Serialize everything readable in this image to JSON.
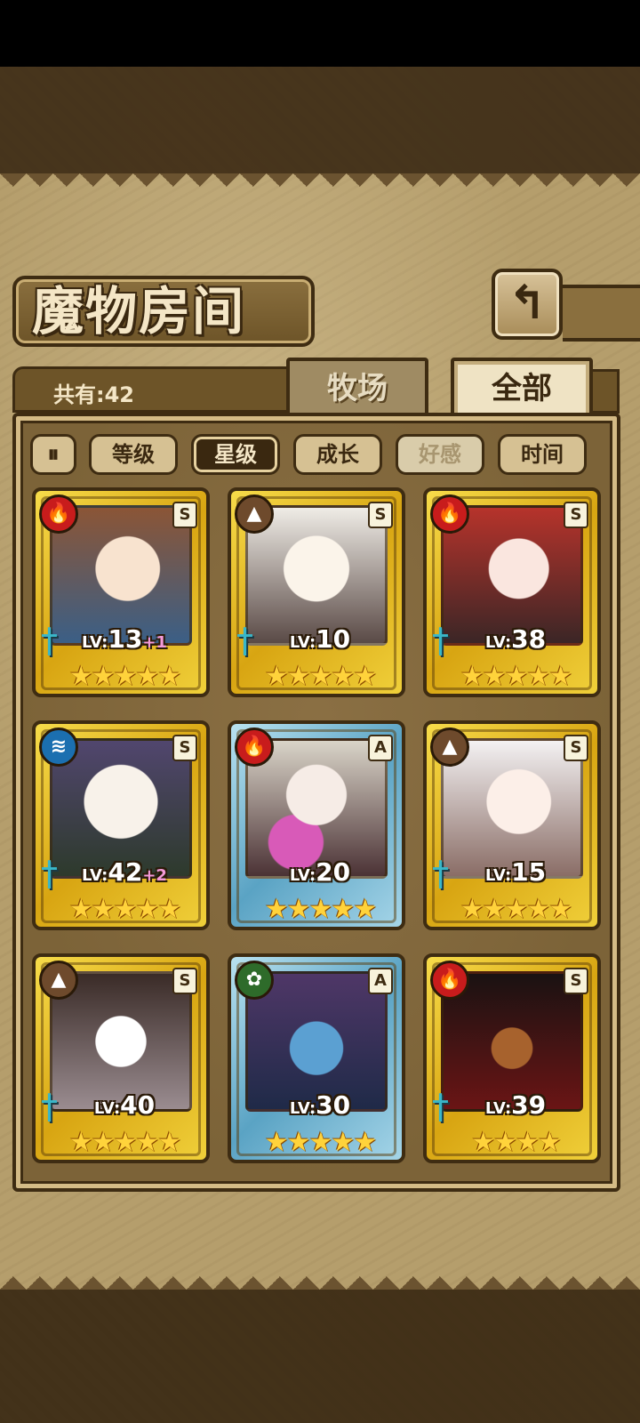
{
  "header": {
    "title": "魔物房间",
    "back_icon": "back-arrow-icon"
  },
  "count": {
    "label": "共有:42"
  },
  "tabs": [
    {
      "label": "牧场",
      "active": false
    },
    {
      "label": "全部",
      "active": true
    }
  ],
  "sort": {
    "toggle_icon": "sort-order-toggle-icon",
    "toggle_glyph": "⏸",
    "buttons": [
      {
        "label": "等级",
        "state": "normal"
      },
      {
        "label": "星级",
        "state": "active"
      },
      {
        "label": "成长",
        "state": "normal"
      },
      {
        "label": "好感",
        "state": "disabled"
      },
      {
        "label": "时间",
        "state": "normal"
      }
    ]
  },
  "cards": [
    {
      "element": "fire",
      "element_glyph": "🔥",
      "rank": "S",
      "lv_prefix": "LV:",
      "lv": "13",
      "plus": "+1",
      "stars": "★★★★★",
      "frame": "gold"
    },
    {
      "element": "earth",
      "element_glyph": "▲",
      "rank": "S",
      "lv_prefix": "LV:",
      "lv": "10",
      "plus": "",
      "stars": "★★★★★",
      "frame": "gold"
    },
    {
      "element": "fire",
      "element_glyph": "🔥",
      "rank": "S",
      "lv_prefix": "LV:",
      "lv": "38",
      "plus": "",
      "stars": "★★★★★",
      "frame": "gold"
    },
    {
      "element": "water",
      "element_glyph": "≋",
      "rank": "S",
      "lv_prefix": "LV:",
      "lv": "42",
      "plus": "+2",
      "stars": "★★★★★",
      "frame": "gold"
    },
    {
      "element": "fire",
      "element_glyph": "🔥",
      "rank": "A",
      "lv_prefix": "LV:",
      "lv": "20",
      "plus": "",
      "stars": "★★★★★",
      "frame": "silver"
    },
    {
      "element": "earth",
      "element_glyph": "▲",
      "rank": "S",
      "lv_prefix": "LV:",
      "lv": "15",
      "plus": "",
      "stars": "★★★★★",
      "frame": "gold"
    },
    {
      "element": "earth",
      "element_glyph": "▲",
      "rank": "S",
      "lv_prefix": "LV:",
      "lv": "40",
      "plus": "",
      "stars": "★★★★★",
      "frame": "gold"
    },
    {
      "element": "wood",
      "element_glyph": "✿",
      "rank": "A",
      "lv_prefix": "LV:",
      "lv": "30",
      "plus": "",
      "stars": "★★★★★",
      "frame": "silver"
    },
    {
      "element": "fire",
      "element_glyph": "🔥",
      "rank": "S",
      "lv_prefix": "LV:",
      "lv": "39",
      "plus": "",
      "stars": "★★★★",
      "frame": "gold"
    }
  ]
}
